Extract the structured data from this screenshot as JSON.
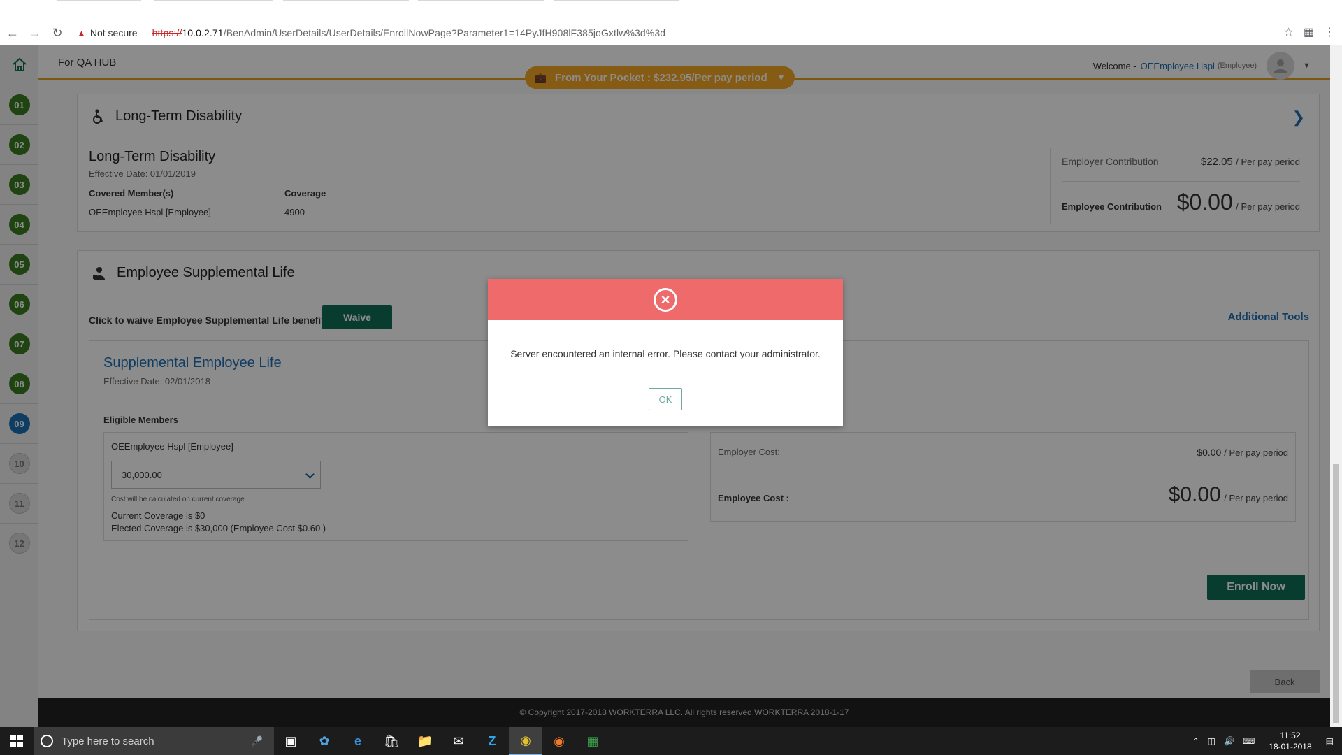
{
  "browser": {
    "security_label": "Not secure",
    "url_scheme": "https://",
    "url_host": "10.0.2.71",
    "url_path": "/BenAdmin/UserDetails/UserDetails/EnrollNowPage?Parameter1=14PyJfH908lF385joGxtlw%3d%3d"
  },
  "header": {
    "org_name": "For QA HUB",
    "welcome_label": "Welcome -",
    "user_name": "OEEmployee Hspl",
    "user_role": "(Employee)",
    "pocket_label": "From Your Pocket : $232.95/Per pay period"
  },
  "steps": [
    {
      "label": "01",
      "state": "done"
    },
    {
      "label": "02",
      "state": "done"
    },
    {
      "label": "03",
      "state": "done"
    },
    {
      "label": "04",
      "state": "done"
    },
    {
      "label": "05",
      "state": "done"
    },
    {
      "label": "06",
      "state": "done"
    },
    {
      "label": "07",
      "state": "done"
    },
    {
      "label": "08",
      "state": "done"
    },
    {
      "label": "09",
      "state": "active"
    },
    {
      "label": "10",
      "state": "pending"
    },
    {
      "label": "11",
      "state": "pending"
    },
    {
      "label": "12",
      "state": "pending"
    }
  ],
  "ltd": {
    "section_title": "Long-Term Disability",
    "plan_title": "Long-Term Disability",
    "effective_date": "Effective Date: 01/01/2019",
    "covered_label": "Covered Member(s)",
    "coverage_label": "Coverage",
    "member": "OEEmployee Hspl [Employee]",
    "coverage_value": "4900",
    "employer_label": "Employer Contribution",
    "employer_value": "$22.05",
    "employer_per": "/ Per pay period",
    "employee_label": "Employee Contribution",
    "employee_value": "$0.00",
    "employee_per": "/ Per pay period"
  },
  "supp": {
    "section_title": "Employee Supplemental Life",
    "waive_text": "Click to waive Employee Supplemental Life benefit",
    "waive_button": "Waive",
    "additional_tools": "Additional Tools",
    "plan_title": "Supplemental Employee Life",
    "effective_date": "Effective Date: 02/01/2018",
    "eligible_label": "Eligible Members",
    "member": "OEEmployee Hspl [Employee]",
    "coverage_selected": "30,000.00",
    "cost_note": "Cost will be calculated on current coverage",
    "current_coverage": "Current Coverage is $0",
    "elected_coverage": "Elected Coverage is $30,000 (Employee Cost $0.60 )",
    "employer_cost_label": "Employer Cost:",
    "employer_cost_value": "$0.00",
    "employer_cost_per": "/ Per pay period",
    "employee_cost_label": "Employee Cost :",
    "employee_cost_value": "$0.00",
    "employee_cost_per": "/ Per pay period",
    "enroll_button": "Enroll Now"
  },
  "back_button": "Back",
  "footer_text": "© Copyright 2017-2018 WORKTERRA LLC. All rights reserved.WORKTERRA 2018-1-17",
  "modal": {
    "message": "Server encountered an internal error. Please contact your administrator.",
    "ok_button": "OK"
  },
  "taskbar": {
    "search_placeholder": "Type here to search",
    "time": "11:52",
    "date": "18-01-2018"
  },
  "colors": {
    "accent_green": "#0e6d56",
    "step_done": "#3a7d1f",
    "step_active": "#1b6fb5",
    "pocket_orange": "#f5a623",
    "modal_header": "#ef6b6b",
    "link_blue": "#1f6fb2"
  }
}
